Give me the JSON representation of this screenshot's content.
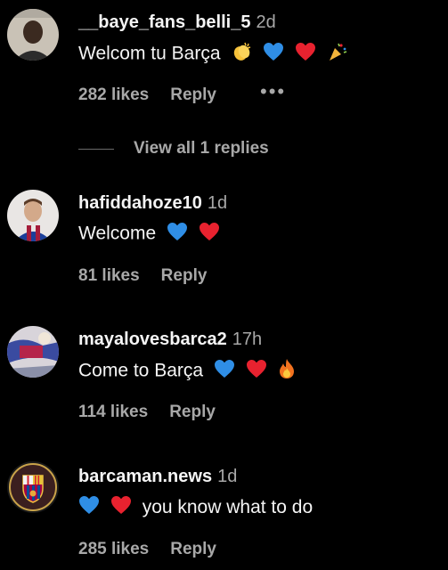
{
  "comments": [
    {
      "username": "__baye_fans_belli_5",
      "time": "2d",
      "text": "Welcom tu Barça",
      "emojis": [
        "clapping-hands",
        "blue-heart",
        "red-heart",
        "party-popper"
      ],
      "likes": "282 likes",
      "reply": "Reply",
      "more": "•••",
      "view_replies": "View all 1 replies"
    },
    {
      "username": "hafiddahoze10",
      "time": "1d",
      "text": "Welcome",
      "emojis": [
        "blue-heart",
        "red-heart"
      ],
      "likes": "81 likes",
      "reply": "Reply"
    },
    {
      "username": "mayalovesbarca2",
      "time": "17h",
      "text": "Come to Barça",
      "emojis": [
        "blue-heart",
        "red-heart",
        "fire"
      ],
      "likes": "114 likes",
      "reply": "Reply"
    },
    {
      "username": "barcaman.news",
      "time": "1d",
      "text": "you know what to do",
      "emojis": [
        "blue-heart",
        "red-heart"
      ],
      "likes": "285 likes",
      "reply": "Reply"
    }
  ],
  "colors": {
    "background": "#000000",
    "primary_text": "#f5f5f5",
    "secondary_text": "#a8a8a8",
    "blue_heart": "#2f8ee6",
    "red_heart": "#e8222f"
  }
}
